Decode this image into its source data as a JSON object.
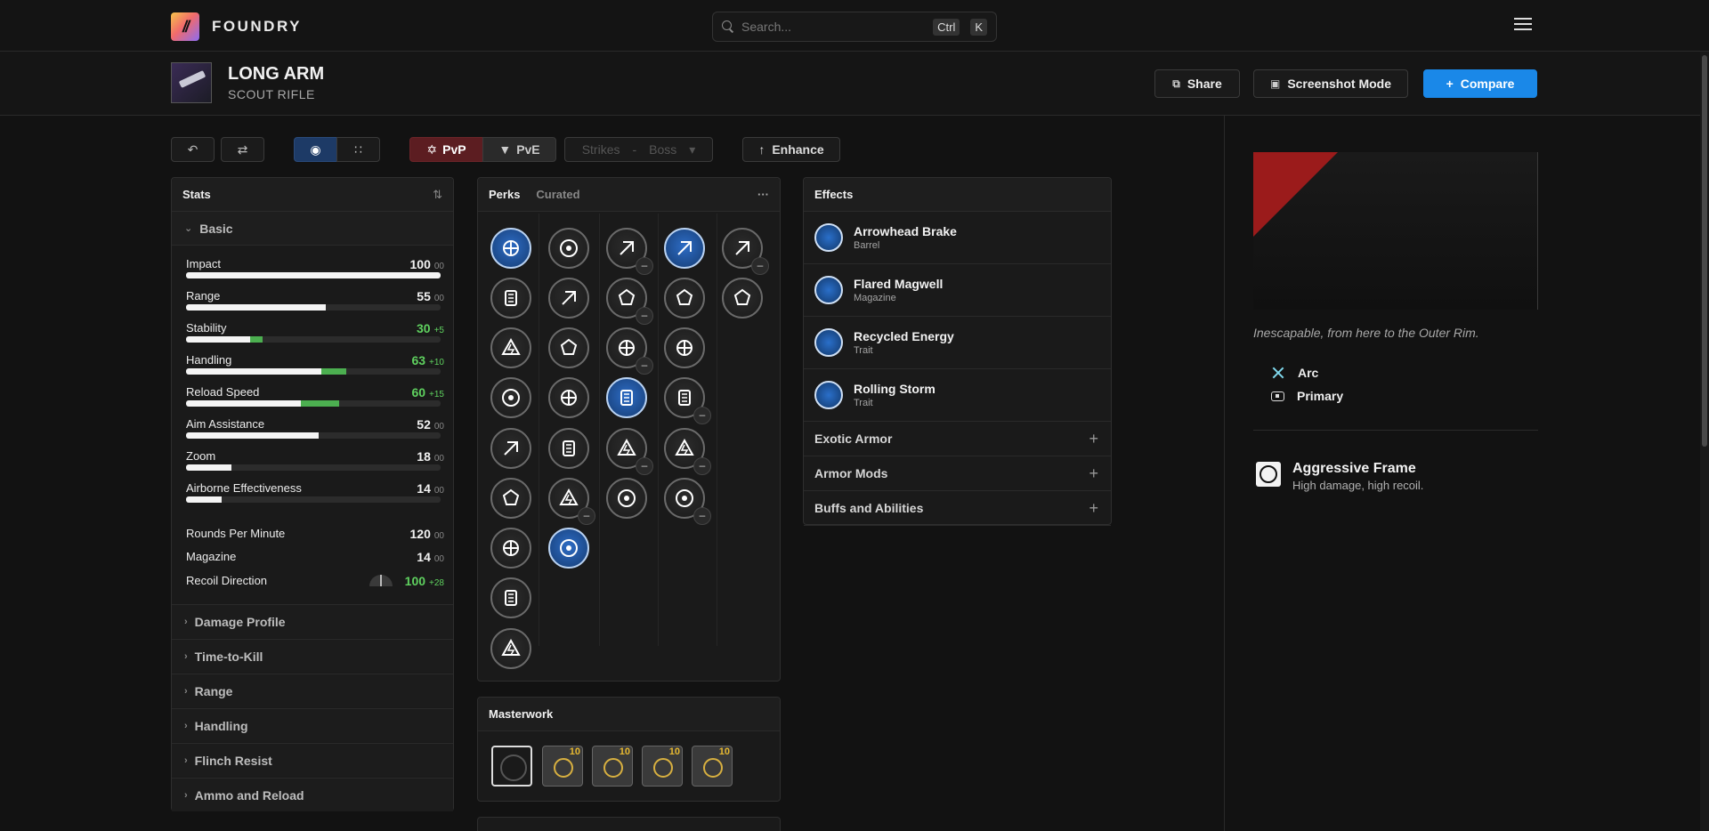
{
  "app": {
    "brand": "FOUNDRY",
    "logo_text": "//"
  },
  "search": {
    "placeholder": "Search...",
    "shortcut_ctrl": "Ctrl",
    "shortcut_key": "K"
  },
  "weapon": {
    "name": "LONG ARM",
    "type": "SCOUT RIFLE"
  },
  "header_buttons": {
    "share": "Share",
    "screenshot": "Screenshot Mode",
    "compare": "Compare"
  },
  "toolbar": {
    "pvp": "PvP",
    "pve": "PvE",
    "activity": "Strikes",
    "difficulty": "Boss",
    "enhance": "Enhance"
  },
  "stats": {
    "title": "Stats",
    "basic_label": "Basic",
    "bars": [
      {
        "label": "Impact",
        "value": "100",
        "delta": "00",
        "base": 100,
        "bonus": 0,
        "green": false
      },
      {
        "label": "Range",
        "value": "55",
        "delta": "00",
        "base": 55,
        "bonus": 0,
        "green": false
      },
      {
        "label": "Stability",
        "value": "30",
        "delta": "+5",
        "base": 25,
        "bonus": 5,
        "green": true
      },
      {
        "label": "Handling",
        "value": "63",
        "delta": "+10",
        "base": 53,
        "bonus": 10,
        "green": true
      },
      {
        "label": "Reload Speed",
        "value": "60",
        "delta": "+15",
        "base": 45,
        "bonus": 15,
        "green": true
      },
      {
        "label": "Aim Assistance",
        "value": "52",
        "delta": "00",
        "base": 52,
        "bonus": 0,
        "green": false
      },
      {
        "label": "Zoom",
        "value": "18",
        "delta": "00",
        "base": 18,
        "bonus": 0,
        "green": false
      },
      {
        "label": "Airborne Effectiveness",
        "value": "14",
        "delta": "00",
        "base": 14,
        "bonus": 0,
        "green": false
      }
    ],
    "plain": [
      {
        "label": "Rounds Per Minute",
        "value": "120",
        "delta": "00"
      },
      {
        "label": "Magazine",
        "value": "14",
        "delta": "00"
      },
      {
        "label": "Recoil Direction",
        "value": "100",
        "delta": "+28"
      }
    ],
    "sections": [
      "Damage Profile",
      "Time-to-Kill",
      "Range",
      "Handling",
      "Flinch Resist",
      "Ammo and Reload"
    ]
  },
  "perks": {
    "tab_perks": "Perks",
    "tab_curated": "Curated",
    "more": "···"
  },
  "effects": {
    "title": "Effects",
    "items": [
      {
        "name": "Arrowhead Brake",
        "type": "Barrel"
      },
      {
        "name": "Flared Magwell",
        "type": "Magazine"
      },
      {
        "name": "Recycled Energy",
        "type": "Trait"
      },
      {
        "name": "Rolling Storm",
        "type": "Trait"
      }
    ],
    "sections": [
      "Exotic Armor",
      "Armor Mods",
      "Buffs and Abilities"
    ]
  },
  "masterwork": {
    "title": "Masterwork",
    "levels": [
      "10",
      "10",
      "10",
      "10"
    ]
  },
  "details": {
    "flavor": "Inescapable, from here to the Outer Rim.",
    "element": "Arc",
    "ammo": "Primary",
    "frame_name": "Aggressive Frame",
    "frame_desc": "High damage, high recoil."
  },
  "colors": {
    "accent": "#1a88e8",
    "pvp": "#5c1d21",
    "bonus": "#4caf50",
    "selected_perk": "#2d6cc5"
  }
}
